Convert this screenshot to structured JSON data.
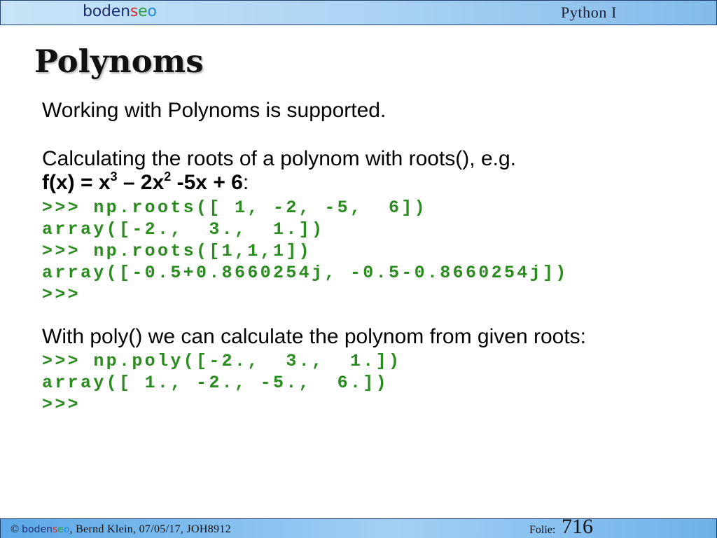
{
  "brand": {
    "parts": [
      {
        "text": "boden",
        "color": "#1f2d73"
      },
      {
        "text": "s",
        "color": "#d32f2f"
      },
      {
        "text": "e",
        "color": "#2e9e44"
      },
      {
        "text": "o",
        "color": "#1f8fd8"
      }
    ]
  },
  "header": {
    "course_title": "Python I"
  },
  "slide": {
    "title": "Polynoms",
    "intro": "Working with Polynoms is supported.",
    "roots_text": "Calculating the roots of a polynom with roots(), e.g.",
    "formula": {
      "base": "f(x) = x",
      "exp1": "3",
      "mid": " – 2x",
      "exp2": "2",
      "tail": " -5x + 6",
      "suffix": ":"
    },
    "roots_code": [
      ">>> np.roots([ 1, -2, -5,  6])",
      "array([-2.,  3.,  1.])",
      ">>> np.roots([1,1,1])",
      "array([-0.5+0.8660254j, -0.5-0.8660254j])",
      ">>>"
    ],
    "poly_text": "With poly() we can calculate the polynom from given roots:",
    "poly_code": [
      ">>> np.poly([-2.,  3.,  1.])",
      "array([ 1., -2., -5.,  6.])",
      ">>>"
    ]
  },
  "footer": {
    "copyright_symbol": "©",
    "credits": ", Bernd Klein, 07/05/17, JOH8912",
    "slide_label": "Folie:",
    "slide_number": "716"
  },
  "colors": {
    "code": "#2a8c1f",
    "text": "#000000"
  }
}
